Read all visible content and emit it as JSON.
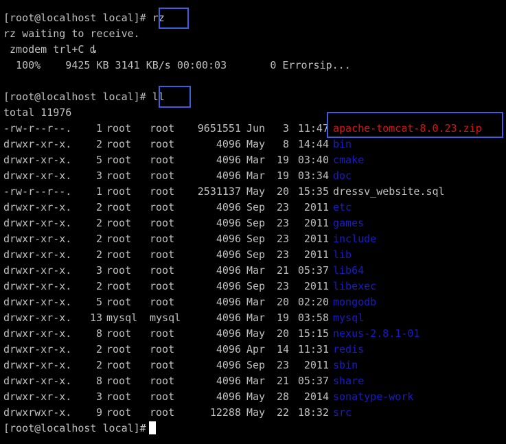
{
  "colors": {
    "background": "#000000",
    "text": "#c0c0c0",
    "directory": "#1a1acc",
    "zip_file": "#e01010",
    "highlight_box": "#3b5fe0",
    "cursor": "#ffffff"
  },
  "terminal": {
    "lines": [
      "[root@localhost local]# rz",
      "rz waiting to receive.",
      " zmodem trl+C ȡ",
      "  100%    9425 KB 3141 KB/s 00:00:03       0 Errorsip...",
      "",
      "[root@localhost local]# ll",
      "total 11976"
    ],
    "listing": [
      {
        "perm": "-rw-r--r--.",
        "links": "1",
        "owner": "root",
        "group": "root",
        "size": "9651551",
        "month": "Jun",
        "day": "3",
        "time": "11:47",
        "name": "apache-tomcat-8.0.23.zip",
        "kind": "zip"
      },
      {
        "perm": "drwxr-xr-x.",
        "links": "2",
        "owner": "root",
        "group": "root",
        "size": "4096",
        "month": "May",
        "day": "8",
        "time": "14:44",
        "name": "bin",
        "kind": "dir"
      },
      {
        "perm": "drwxr-xr-x.",
        "links": "5",
        "owner": "root",
        "group": "root",
        "size": "4096",
        "month": "Mar",
        "day": "19",
        "time": "03:40",
        "name": "cmake",
        "kind": "dir"
      },
      {
        "perm": "drwxr-xr-x.",
        "links": "3",
        "owner": "root",
        "group": "root",
        "size": "4096",
        "month": "Mar",
        "day": "19",
        "time": "03:34",
        "name": "doc",
        "kind": "dir"
      },
      {
        "perm": "-rw-r--r--.",
        "links": "1",
        "owner": "root",
        "group": "root",
        "size": "2531137",
        "month": "May",
        "day": "20",
        "time": "15:35",
        "name": "dressv_website.sql",
        "kind": "file"
      },
      {
        "perm": "drwxr-xr-x.",
        "links": "2",
        "owner": "root",
        "group": "root",
        "size": "4096",
        "month": "Sep",
        "day": "23",
        "time": "2011",
        "name": "etc",
        "kind": "dir"
      },
      {
        "perm": "drwxr-xr-x.",
        "links": "2",
        "owner": "root",
        "group": "root",
        "size": "4096",
        "month": "Sep",
        "day": "23",
        "time": "2011",
        "name": "games",
        "kind": "dir"
      },
      {
        "perm": "drwxr-xr-x.",
        "links": "2",
        "owner": "root",
        "group": "root",
        "size": "4096",
        "month": "Sep",
        "day": "23",
        "time": "2011",
        "name": "include",
        "kind": "dir"
      },
      {
        "perm": "drwxr-xr-x.",
        "links": "2",
        "owner": "root",
        "group": "root",
        "size": "4096",
        "month": "Sep",
        "day": "23",
        "time": "2011",
        "name": "lib",
        "kind": "dir"
      },
      {
        "perm": "drwxr-xr-x.",
        "links": "3",
        "owner": "root",
        "group": "root",
        "size": "4096",
        "month": "Mar",
        "day": "21",
        "time": "05:37",
        "name": "lib64",
        "kind": "dir"
      },
      {
        "perm": "drwxr-xr-x.",
        "links": "2",
        "owner": "root",
        "group": "root",
        "size": "4096",
        "month": "Sep",
        "day": "23",
        "time": "2011",
        "name": "libexec",
        "kind": "dir"
      },
      {
        "perm": "drwxr-xr-x.",
        "links": "5",
        "owner": "root",
        "group": "root",
        "size": "4096",
        "month": "Mar",
        "day": "20",
        "time": "02:20",
        "name": "mongodb",
        "kind": "dir"
      },
      {
        "perm": "drwxr-xr-x.",
        "links": "13",
        "owner": "mysql",
        "group": "mysql",
        "size": "4096",
        "month": "Mar",
        "day": "19",
        "time": "03:58",
        "name": "mysql",
        "kind": "dir"
      },
      {
        "perm": "drwxr-xr-x.",
        "links": "8",
        "owner": "root",
        "group": "root",
        "size": "4096",
        "month": "May",
        "day": "20",
        "time": "15:15",
        "name": "nexus-2.8.1-01",
        "kind": "dir"
      },
      {
        "perm": "drwxr-xr-x.",
        "links": "2",
        "owner": "root",
        "group": "root",
        "size": "4096",
        "month": "Apr",
        "day": "14",
        "time": "11:31",
        "name": "redis",
        "kind": "dir"
      },
      {
        "perm": "drwxr-xr-x.",
        "links": "2",
        "owner": "root",
        "group": "root",
        "size": "4096",
        "month": "Sep",
        "day": "23",
        "time": "2011",
        "name": "sbin",
        "kind": "dir"
      },
      {
        "perm": "drwxr-xr-x.",
        "links": "8",
        "owner": "root",
        "group": "root",
        "size": "4096",
        "month": "Mar",
        "day": "21",
        "time": "05:37",
        "name": "share",
        "kind": "dir"
      },
      {
        "perm": "drwxr-xr-x.",
        "links": "3",
        "owner": "root",
        "group": "root",
        "size": "4096",
        "month": "May",
        "day": "28",
        "time": "2014",
        "name": "sonatype-work",
        "kind": "dir"
      },
      {
        "perm": "drwxrwxr-x.",
        "links": "9",
        "owner": "root",
        "group": "root",
        "size": "12288",
        "month": "May",
        "day": "22",
        "time": "18:32",
        "name": "src",
        "kind": "dir"
      }
    ],
    "final_prompt": "[root@localhost local]#"
  }
}
